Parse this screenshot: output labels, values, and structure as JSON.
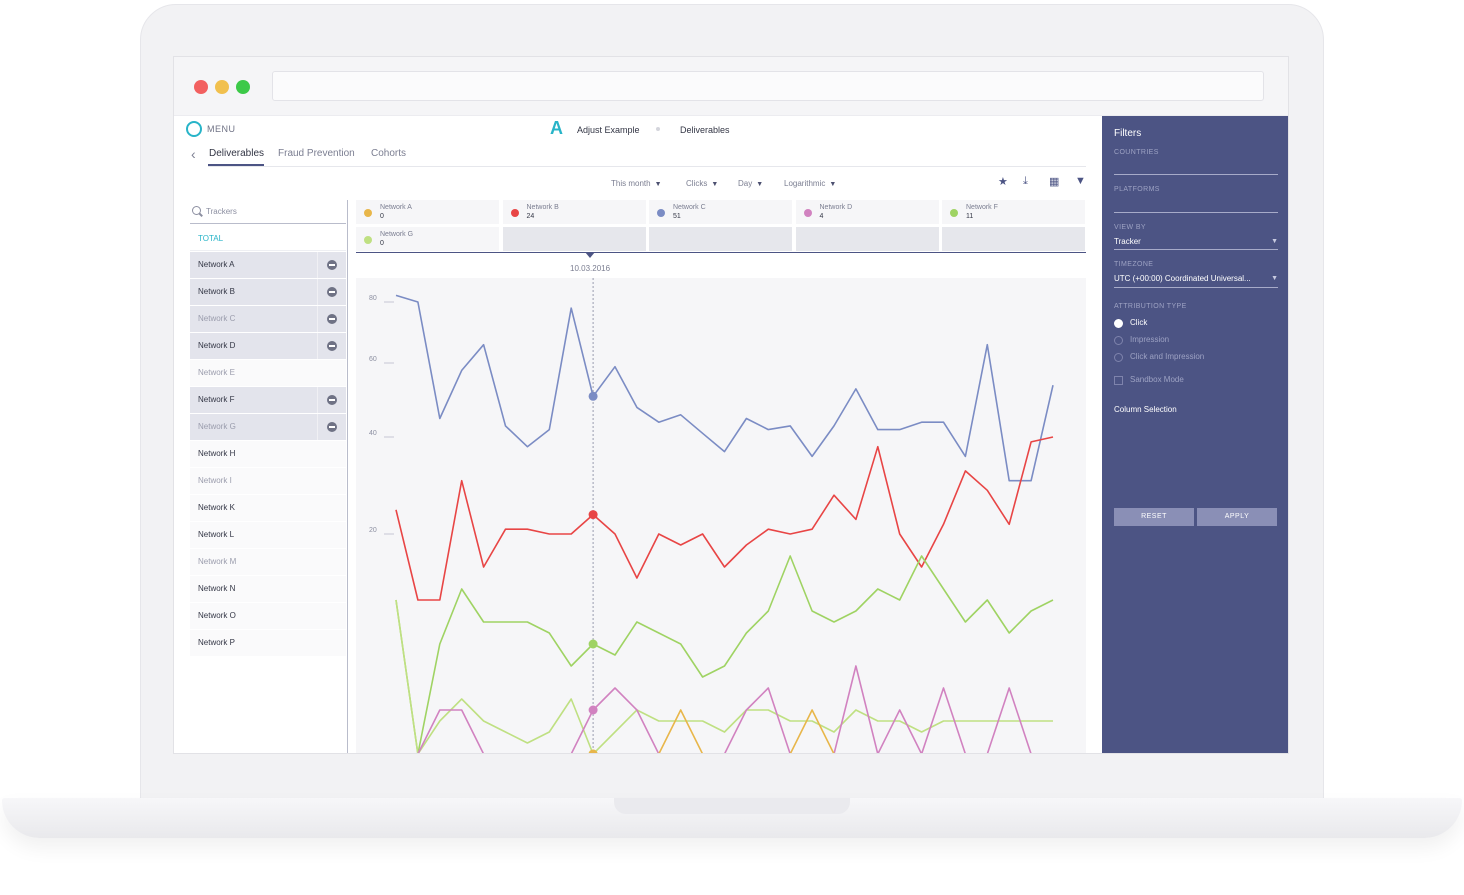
{
  "header": {
    "menu_label": "MENU",
    "app_name": "Adjust Example",
    "breadcrumb": "Deliverables"
  },
  "tabs": [
    {
      "label": "Deliverables",
      "active": true
    },
    {
      "label": "Fraud Prevention",
      "active": false
    },
    {
      "label": "Cohorts",
      "active": false
    }
  ],
  "toolbar": {
    "period": "This month",
    "metric": "Clicks",
    "granularity": "Day",
    "scale": "Logarithmic",
    "icons": [
      "star-settings-icon",
      "download-icon",
      "table-icon",
      "filter-icon"
    ]
  },
  "sidebar": {
    "search_placeholder": "Trackers",
    "total_label": "TOTAL",
    "trackers": [
      {
        "name": "Network A",
        "selected": true,
        "dim": false
      },
      {
        "name": "Network B",
        "selected": true,
        "dim": false
      },
      {
        "name": "Network C",
        "selected": true,
        "dim": true
      },
      {
        "name": "Network D",
        "selected": true,
        "dim": false
      },
      {
        "name": "Network E",
        "selected": false,
        "dim": true
      },
      {
        "name": "Network F",
        "selected": true,
        "dim": false
      },
      {
        "name": "Network G",
        "selected": true,
        "dim": true
      },
      {
        "name": "Network H",
        "selected": false,
        "dim": false
      },
      {
        "name": "Network I",
        "selected": false,
        "dim": true
      },
      {
        "name": "Network K",
        "selected": false,
        "dim": false
      },
      {
        "name": "Network L",
        "selected": false,
        "dim": false
      },
      {
        "name": "Network M",
        "selected": false,
        "dim": true
      },
      {
        "name": "Network N",
        "selected": false,
        "dim": false
      },
      {
        "name": "Network O",
        "selected": false,
        "dim": false
      },
      {
        "name": "Network P",
        "selected": false,
        "dim": false
      }
    ]
  },
  "legend": [
    {
      "name": "Network A",
      "value": "0",
      "color": "#e8b64a"
    },
    {
      "name": "Network B",
      "value": "24",
      "color": "#e84545"
    },
    {
      "name": "Network C",
      "value": "51",
      "color": "#7b8cc4"
    },
    {
      "name": "Network D",
      "value": "4",
      "color": "#d182c0"
    },
    {
      "name": "Network F",
      "value": "11",
      "color": "#9fd363"
    },
    {
      "name": "Network G",
      "value": "0",
      "color": "#bfe082"
    }
  ],
  "chart_data": {
    "type": "line",
    "hover_date": "10.03.2016",
    "y_ticks": [
      "80",
      "60",
      "40",
      "20"
    ],
    "hover_index": 9,
    "series": [
      {
        "name": "Network C",
        "color": "#7b8cc4",
        "values": [
          83,
          80,
          45,
          58,
          66,
          43,
          38,
          42,
          78,
          51,
          59,
          48,
          44,
          46,
          41,
          37,
          45,
          42,
          43,
          36,
          43,
          53,
          42,
          42,
          44,
          44,
          36,
          66,
          31,
          31,
          54
        ]
      },
      {
        "name": "Network B",
        "color": "#e84545",
        "values": [
          25,
          14,
          14,
          31,
          17,
          21,
          21,
          20,
          20,
          24,
          20,
          16,
          20,
          19,
          20,
          17,
          19,
          21,
          20,
          21,
          28,
          23,
          38,
          20,
          17,
          22,
          33,
          29,
          22,
          39,
          40
        ]
      },
      {
        "name": "Network F",
        "color": "#9fd363",
        "values": [
          14,
          0,
          10,
          15,
          12,
          12,
          12,
          11,
          8,
          10,
          9,
          12,
          11,
          10,
          7,
          8,
          11,
          13,
          18,
          13,
          12,
          13,
          15,
          14,
          18,
          15,
          12,
          14,
          11,
          13,
          14
        ]
      },
      {
        "name": "Network G",
        "color": "#bfe082",
        "values": [
          14,
          0,
          3,
          5,
          3,
          2,
          1,
          2,
          5,
          0,
          2,
          4,
          3,
          3,
          3,
          2,
          4,
          4,
          3,
          3,
          2,
          4,
          3,
          3,
          2,
          3,
          3,
          3,
          3,
          3,
          3
        ]
      },
      {
        "name": "Network D",
        "color": "#d182c0",
        "values": [
          0,
          0,
          4,
          4,
          0,
          0,
          0,
          0,
          0,
          4,
          6,
          4,
          0,
          0,
          0,
          0,
          4,
          6,
          0,
          0,
          0,
          8,
          0,
          4,
          0,
          6,
          0,
          0,
          6,
          0,
          0
        ]
      },
      {
        "name": "Network A",
        "color": "#e8b64a",
        "values": [
          0,
          0,
          0,
          0,
          0,
          0,
          0,
          0,
          0,
          0,
          0,
          0,
          0,
          4,
          0,
          0,
          0,
          0,
          0,
          4,
          0,
          0,
          0,
          0,
          0,
          0,
          0,
          0,
          0,
          0,
          0
        ]
      }
    ]
  },
  "filters": {
    "title": "Filters",
    "countries_label": "COUNTRIES",
    "platforms_label": "PLATFORMS",
    "view_by_label": "VIEW BY",
    "view_by_value": "Tracker",
    "timezone_label": "TIMEZONE",
    "timezone_value": "UTC (+00:00) Coordinated Universal...",
    "attribution_label": "ATTRIBUTION TYPE",
    "attribution_options": [
      "Click",
      "Impression",
      "Click and Impression"
    ],
    "sandbox_label": "Sandbox Mode",
    "column_selection_label": "Column Selection",
    "reset_label": "RESET",
    "apply_label": "APPLY"
  }
}
